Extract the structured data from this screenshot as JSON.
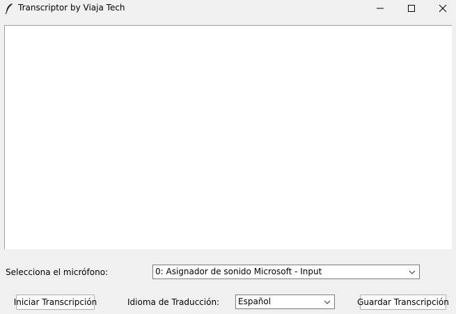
{
  "window": {
    "title": "Transcriptor by Viaja Tech"
  },
  "mic": {
    "label": "Selecciona el micrófono:",
    "selected": "0: Asignador de sonido Microsoft - Input"
  },
  "actions": {
    "start_label": "Iniciar Transcripción",
    "save_label": "Guardar Transcripción"
  },
  "language": {
    "label": "Idioma de Traducción:",
    "selected": "Español"
  }
}
